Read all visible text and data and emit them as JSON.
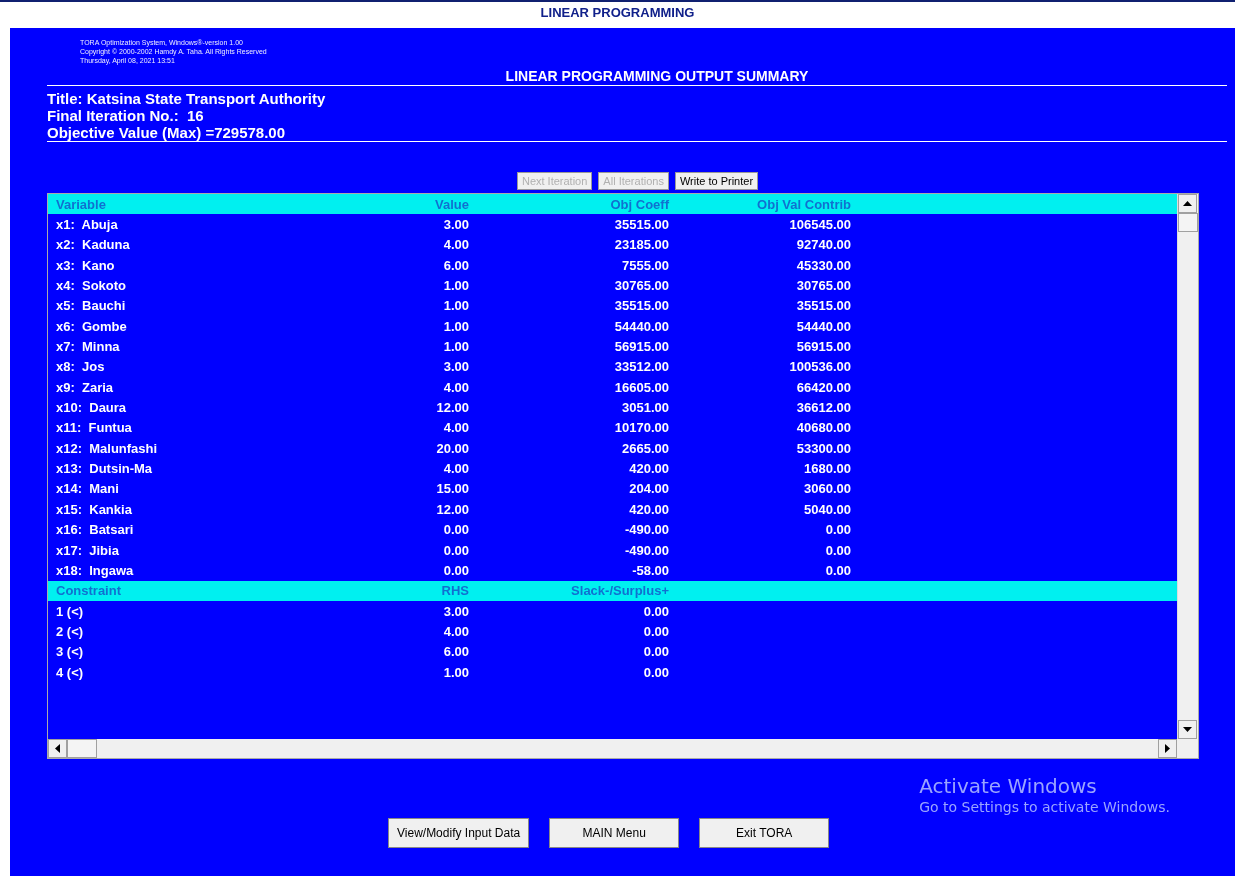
{
  "window": {
    "title": "LINEAR PROGRAMMING"
  },
  "info_lines": [
    "TORA Optimization System, Windows®-version 1.00",
    "Copyright © 2000-2002 Hamdy A. Taha.  All Rights Reserved",
    "Thursday, April 08, 2021 13:51"
  ],
  "heading": "LINEAR PROGRAMMING OUTPUT SUMMARY",
  "summary": [
    "Title: Katsina State Transport Authority",
    "Final Iteration No.:  16",
    "Objective Value (Max) =729578.00"
  ],
  "toolbar": [
    {
      "label": "Next Iteration",
      "disabled": true
    },
    {
      "label": "All Iterations",
      "disabled": true
    },
    {
      "label": "Write to Printer",
      "disabled": false
    }
  ],
  "table": {
    "sections": [
      {
        "columns": [
          "Variable",
          "Value",
          "Obj Coeff",
          "Obj Val Contrib"
        ],
        "rows": [
          [
            "x1:  Abuja",
            "3.00",
            "35515.00",
            "106545.00"
          ],
          [
            "x2:  Kaduna",
            "4.00",
            "23185.00",
            "92740.00"
          ],
          [
            "x3:  Kano",
            "6.00",
            "7555.00",
            "45330.00"
          ],
          [
            "x4:  Sokoto",
            "1.00",
            "30765.00",
            "30765.00"
          ],
          [
            "x5:  Bauchi",
            "1.00",
            "35515.00",
            "35515.00"
          ],
          [
            "x6:  Gombe",
            "1.00",
            "54440.00",
            "54440.00"
          ],
          [
            "x7:  Minna",
            "1.00",
            "56915.00",
            "56915.00"
          ],
          [
            "x8:  Jos",
            "3.00",
            "33512.00",
            "100536.00"
          ],
          [
            "x9:  Zaria",
            "4.00",
            "16605.00",
            "66420.00"
          ],
          [
            "x10:  Daura",
            "12.00",
            "3051.00",
            "36612.00"
          ],
          [
            "x11:  Funtua",
            "4.00",
            "10170.00",
            "40680.00"
          ],
          [
            "x12:  Malunfashi",
            "20.00",
            "2665.00",
            "53300.00"
          ],
          [
            "x13:  Dutsin-Ma",
            "4.00",
            "420.00",
            "1680.00"
          ],
          [
            "x14:  Mani",
            "15.00",
            "204.00",
            "3060.00"
          ],
          [
            "x15:  Kankia",
            "12.00",
            "420.00",
            "5040.00"
          ],
          [
            "x16:  Batsari",
            "0.00",
            "-490.00",
            "0.00"
          ],
          [
            "x17:  Jibia",
            "0.00",
            "-490.00",
            "0.00"
          ],
          [
            "x18:  Ingawa",
            "0.00",
            "-58.00",
            "0.00"
          ]
        ]
      },
      {
        "columns": [
          "Constraint",
          "RHS",
          "Slack-/Surplus+"
        ],
        "rows": [
          [
            "1 (<)",
            "3.00",
            "0.00"
          ],
          [
            "2 (<)",
            "4.00",
            "0.00"
          ],
          [
            "3 (<)",
            "6.00",
            "0.00"
          ],
          [
            "4 (<)",
            "1.00",
            "0.00"
          ]
        ]
      }
    ]
  },
  "buttons": [
    "View/Modify Input Data",
    "MAIN Menu",
    "Exit TORA"
  ],
  "activation_notice": {
    "title": "Activate Windows",
    "message": "Go to Settings to activate Windows."
  }
}
